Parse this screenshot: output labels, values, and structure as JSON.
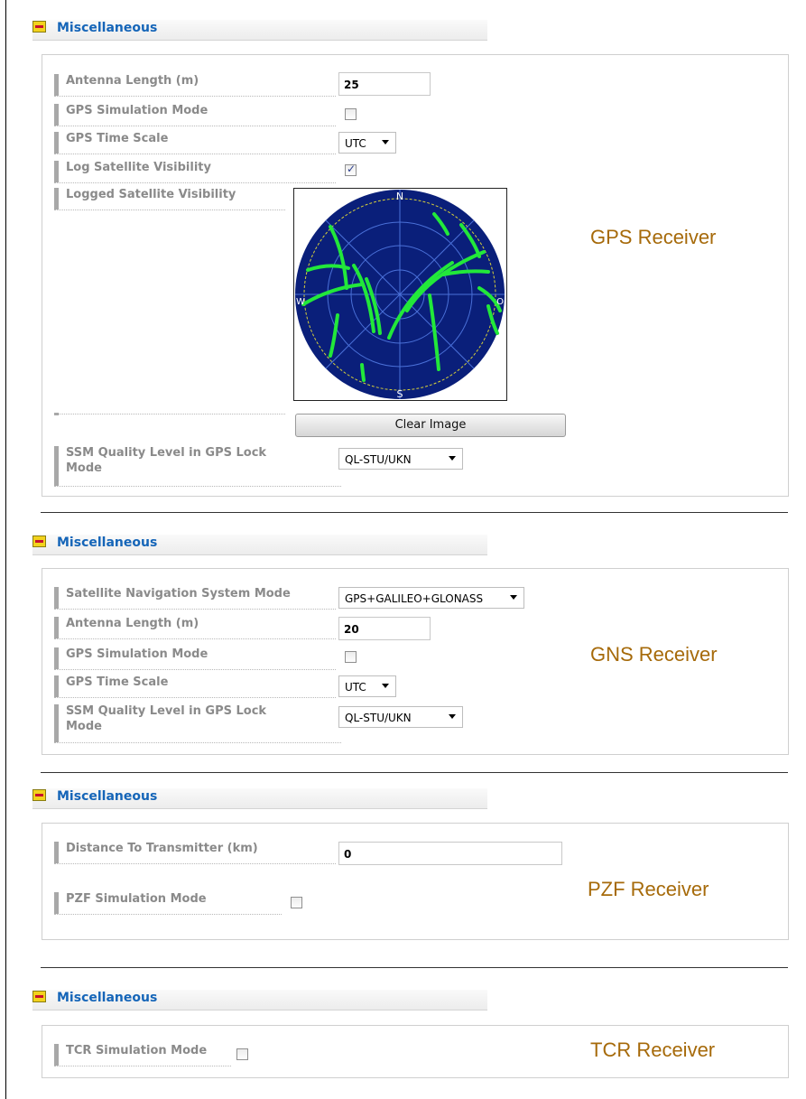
{
  "sections": [
    {
      "header": "Miscellaneous",
      "receiver": "GPS Receiver",
      "antenna_label": "Antenna Length (m)",
      "antenna_value": "25",
      "sim_label": "GPS Simulation Mode",
      "sim_checked": false,
      "timescale_label": "GPS Time Scale",
      "timescale_value": "UTC",
      "logvis_label": "Log Satellite Visibility",
      "logvis_checked": true,
      "loggedvis_label": "Logged Satellite Visibility",
      "skyplot": {
        "north": "N",
        "south": "S",
        "west": "W",
        "east": "O",
        "bg_color": "#0a1f7a",
        "track_color": "#22e83a",
        "ring_color": "#4a70d8",
        "horizon_color": "#d6cf3a"
      },
      "clear_button": "Clear Image",
      "ssm_label_line1": "SSM Quality Level in GPS Lock",
      "ssm_label_line2": "Mode",
      "ssm_value": "QL-STU/UKN"
    },
    {
      "header": "Miscellaneous",
      "receiver": "GNS Receiver",
      "satnav_label": "Satellite Navigation System Mode",
      "satnav_value": "GPS+GALILEO+GLONASS",
      "antenna_label": "Antenna Length (m)",
      "antenna_value": "20",
      "sim_label": "GPS Simulation Mode",
      "sim_checked": false,
      "timescale_label": "GPS Time Scale",
      "timescale_value": "UTC",
      "ssm_label_line1": "SSM Quality Level in GPS Lock",
      "ssm_label_line2": "Mode",
      "ssm_value": "QL-STU/UKN"
    },
    {
      "header": "Miscellaneous",
      "receiver": "PZF Receiver",
      "distance_label": "Distance To Transmitter (km)",
      "distance_value": "0",
      "sim_label": "PZF Simulation Mode",
      "sim_checked": false
    },
    {
      "header": "Miscellaneous",
      "receiver": "TCR Receiver",
      "sim_label": "TCR Simulation Mode",
      "sim_checked": false
    }
  ]
}
